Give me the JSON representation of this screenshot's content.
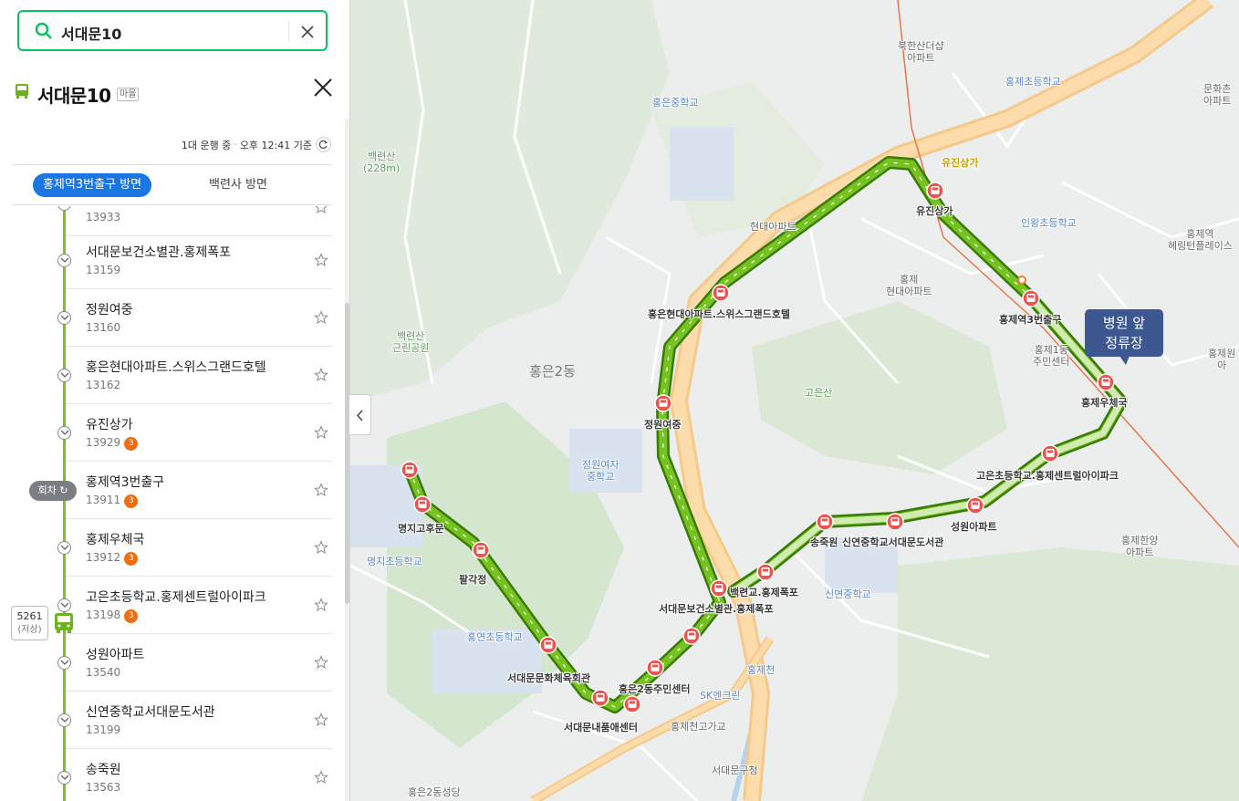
{
  "search": {
    "query": "서대문10"
  },
  "route": {
    "name": "서대문10",
    "type": "마을"
  },
  "status": {
    "running": "1대 운행 중",
    "time": "오후 12:41 기준"
  },
  "tabs": [
    {
      "label": "홍제역3번출구 방면"
    },
    {
      "label": "백련사 방면"
    }
  ],
  "stops": [
    {
      "name": "",
      "id": "13933",
      "badge": ""
    },
    {
      "name": "서대문보건소별관.홍제폭포",
      "id": "13159",
      "badge": ""
    },
    {
      "name": "정원여중",
      "id": "13160",
      "badge": ""
    },
    {
      "name": "홍은현대아파트.스위스그랜드호텔",
      "id": "13162",
      "badge": ""
    },
    {
      "name": "유진상가",
      "id": "13929",
      "badge": "3"
    },
    {
      "name": "홍제역3번출구",
      "id": "13911",
      "badge": "3"
    },
    {
      "name": "홍제우체국",
      "id": "13912",
      "badge": "3"
    },
    {
      "name": "고은초등학교.홍제센트럴아이파크",
      "id": "13198",
      "badge": "3"
    },
    {
      "name": "성원아파트",
      "id": "13540",
      "badge": ""
    },
    {
      "name": "신연중학교서대문도서관",
      "id": "13199",
      "badge": ""
    },
    {
      "name": "송죽원",
      "id": "13563",
      "badge": ""
    }
  ],
  "turnaround": "회차",
  "bus": {
    "number": "5261",
    "sub": "(저상)"
  },
  "map": {
    "callout": [
      "병원 앞",
      "정류장"
    ],
    "stop_labels": {
      "yujin": "유진상가",
      "hongje3": "홍제역3번출구",
      "hongjepost": "홍제우체국",
      "hyundai": "홍은현대아파트.스위스그랜드호텔",
      "jeongwon": "정원여중",
      "goeun": "고은초등학교.홍제센트럴아이파크",
      "seongwon": "성원아파트",
      "songjuk": "송죽원",
      "sinyeon": "신연중학교서대문도서관",
      "baekryeon": "백련교.홍제폭포",
      "health": "서대문보건소별관.홍제폭포",
      "hongeun2": "홍은2동주민센터",
      "culture": "서대문문화체육회관",
      "naepum": "서대문내품애센터",
      "palgak": "팔각정",
      "myeongji": "명지고후문"
    },
    "places": {
      "bukhansan": [
        "북한산더샵",
        "아파트"
      ],
      "hongje_elem": "홍제초등학교",
      "hongeun_mid": "홍은중학교",
      "baekryeonsan": [
        "백련산",
        "(228m)"
      ],
      "yujin_mall": "유진상가",
      "hyundai_apt": "현대아파트",
      "inwang_elem": "인왕초등학교",
      "hongje_station": [
        "홍제역",
        "헤링턴플레이스"
      ],
      "hongje_hyundai": [
        "홍제",
        "현대아파트"
      ],
      "baekryeon_park": [
        "백련산",
        "근린공원"
      ],
      "hongeun2dong": "홍은2동",
      "hongje1_center": [
        "홍제1동",
        "주민센터"
      ],
      "goeunsan": "고은산",
      "jeongwon_girls": [
        "정원여자",
        "중학교"
      ],
      "myeongji_elem": "명지초등학교",
      "sinyeon_mid": "신연중학교",
      "hongyeon_elem": "홍연초등학교",
      "hongjecheon": "홍제천",
      "sk_encrin": "SK엔크린",
      "hongjecheon_high": "홍제천고가교",
      "seodaemun_office": "서대문구청",
      "hongeun2_church": "홍은2동성당",
      "hongje_hanyang": [
        "홍제한양",
        "아파트"
      ],
      "munhwa": [
        "문화촌",
        "아파트"
      ],
      "hongje_right": [
        "홍제원",
        "아"
      ]
    }
  },
  "colors": {
    "accent": "#03c75a",
    "tab_active": "#1a76e3",
    "route": "#6fb21f",
    "badge": "#f06c10",
    "stop_pin": "#ef5350",
    "callout": "#3d5891"
  }
}
